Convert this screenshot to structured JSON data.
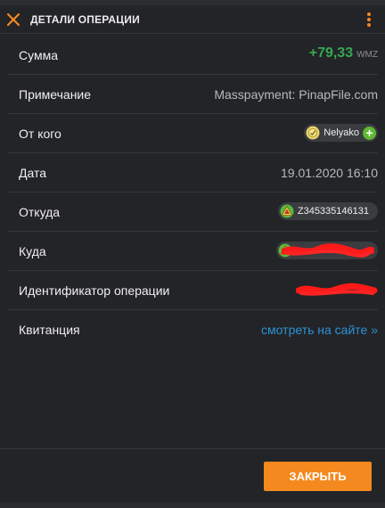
{
  "header": {
    "title": "ДЕТАЛИ ОПЕРАЦИИ"
  },
  "colors": {
    "accent": "#f4891f",
    "amount_positive": "#34a853",
    "link": "#2c93d6",
    "background": "#232427"
  },
  "details": {
    "amount": {
      "label": "Сумма",
      "value": "+79,33",
      "currency": "WMZ"
    },
    "note": {
      "label": "Примечание",
      "value": "Masspayment: PinapFile.com"
    },
    "from": {
      "label": "От кого",
      "name": "Nelyako",
      "icon": "wm-passport-icon",
      "action_icon": "add-contact-icon"
    },
    "date": {
      "label": "Дата",
      "value": "19.01.2020 16:10"
    },
    "source": {
      "label": "Откуда",
      "purse": "Z345335146131",
      "icon": "wm-purse-icon"
    },
    "destination": {
      "label": "Куда",
      "icon": "wm-purse-icon"
    },
    "operation_id": {
      "label": "Идентификатор операции"
    },
    "receipt": {
      "label": "Квитанция",
      "link_text": "смотреть на сайте »"
    }
  },
  "actions": {
    "close_label": "ЗАКРЫТЬ"
  }
}
